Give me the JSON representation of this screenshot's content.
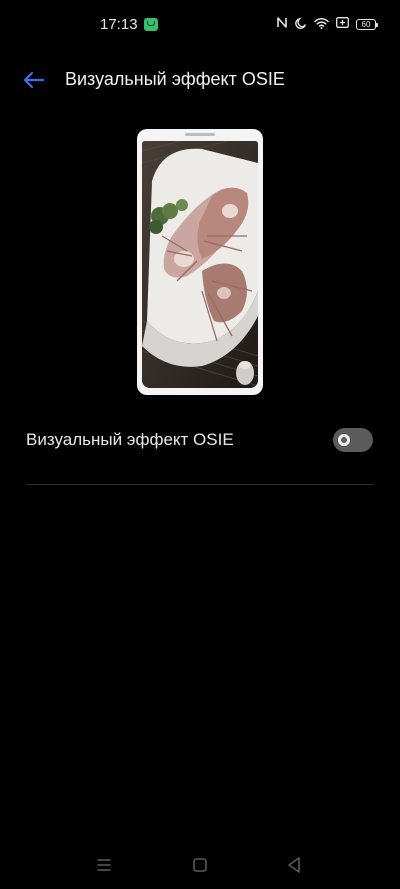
{
  "status_bar": {
    "time": "17:13",
    "battery": "60",
    "icons": [
      "message-notification-icon",
      "nfc-icon",
      "moon-icon",
      "wifi-icon",
      "battery-saver-icon",
      "battery-icon"
    ]
  },
  "header": {
    "back_icon": "arrow-left-icon",
    "title": "Визуальный эффект OSIE"
  },
  "preview": {
    "image": "lobster-dish-photo"
  },
  "settings": {
    "osie_label": "Визуальный эффект OSIE",
    "osie_enabled": false
  },
  "nav_bar": {
    "icons": [
      "menu-icon",
      "home-icon",
      "back-icon"
    ]
  },
  "colors": {
    "background": "#000000",
    "accent": "#3b6ff0",
    "toggle_off": "#5b5b5b"
  }
}
